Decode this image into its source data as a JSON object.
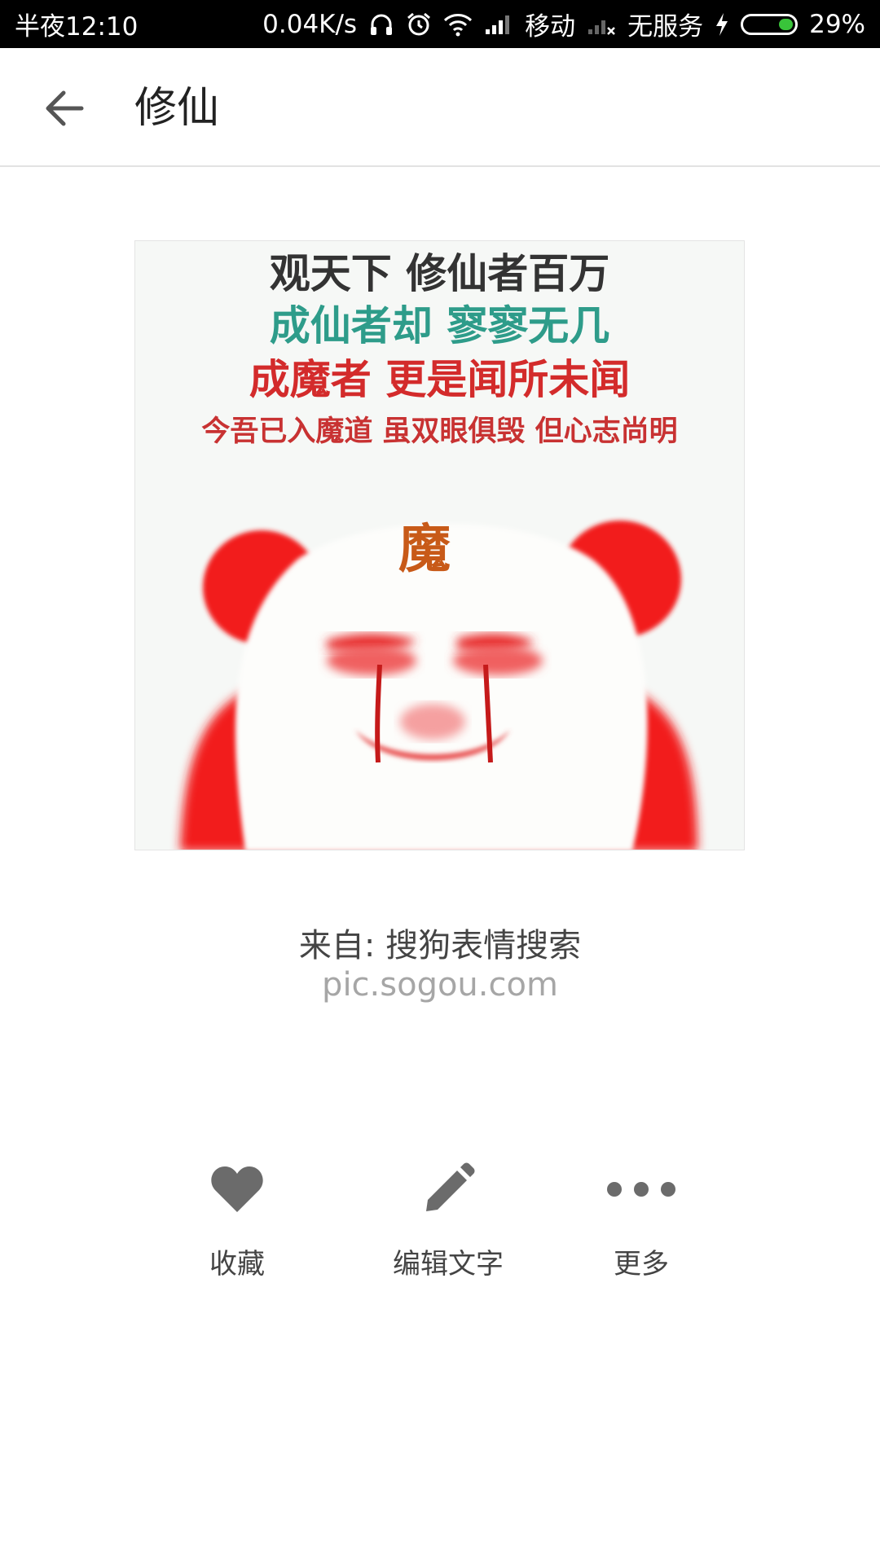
{
  "status_bar": {
    "time": "半夜12:10",
    "speed": "0.04K/s",
    "carrier": "移动",
    "service": "无服务",
    "battery": "29%",
    "battery_level": 0.29,
    "icons": [
      "headphones-icon",
      "alarm-icon",
      "wifi-icon",
      "signal-icon",
      "no-signal-icon",
      "charging-icon",
      "battery-icon"
    ]
  },
  "app_bar": {
    "title": "修仙",
    "back_icon": "arrow-left-icon"
  },
  "meme": {
    "line1": "观天下  修仙者百万",
    "line2": "成仙者却  寥寥无几",
    "line3": "成魔者  更是闻所未闻",
    "line4": "今吾已入魔道  虽双眼俱毁  但心志尚明",
    "forehead": "魔",
    "colors": {
      "line1": "#333333",
      "line2": "#2e9c8a",
      "line3": "#d32b2b",
      "line4": "#c83232",
      "panda_red": "#f21f1f",
      "forehead": "#c85a18"
    }
  },
  "source": {
    "label": "来自: 搜狗表情搜索",
    "url": "pic.sogou.com"
  },
  "actions": [
    {
      "label": "收藏",
      "icon": "heart-icon"
    },
    {
      "label": "编辑文字",
      "icon": "pencil-icon"
    },
    {
      "label": "更多",
      "icon": "more-dots-icon"
    }
  ],
  "colors": {
    "icon_gray": "#6b6b6b",
    "text_dark": "#444444",
    "text_light": "#a6a6a6"
  }
}
